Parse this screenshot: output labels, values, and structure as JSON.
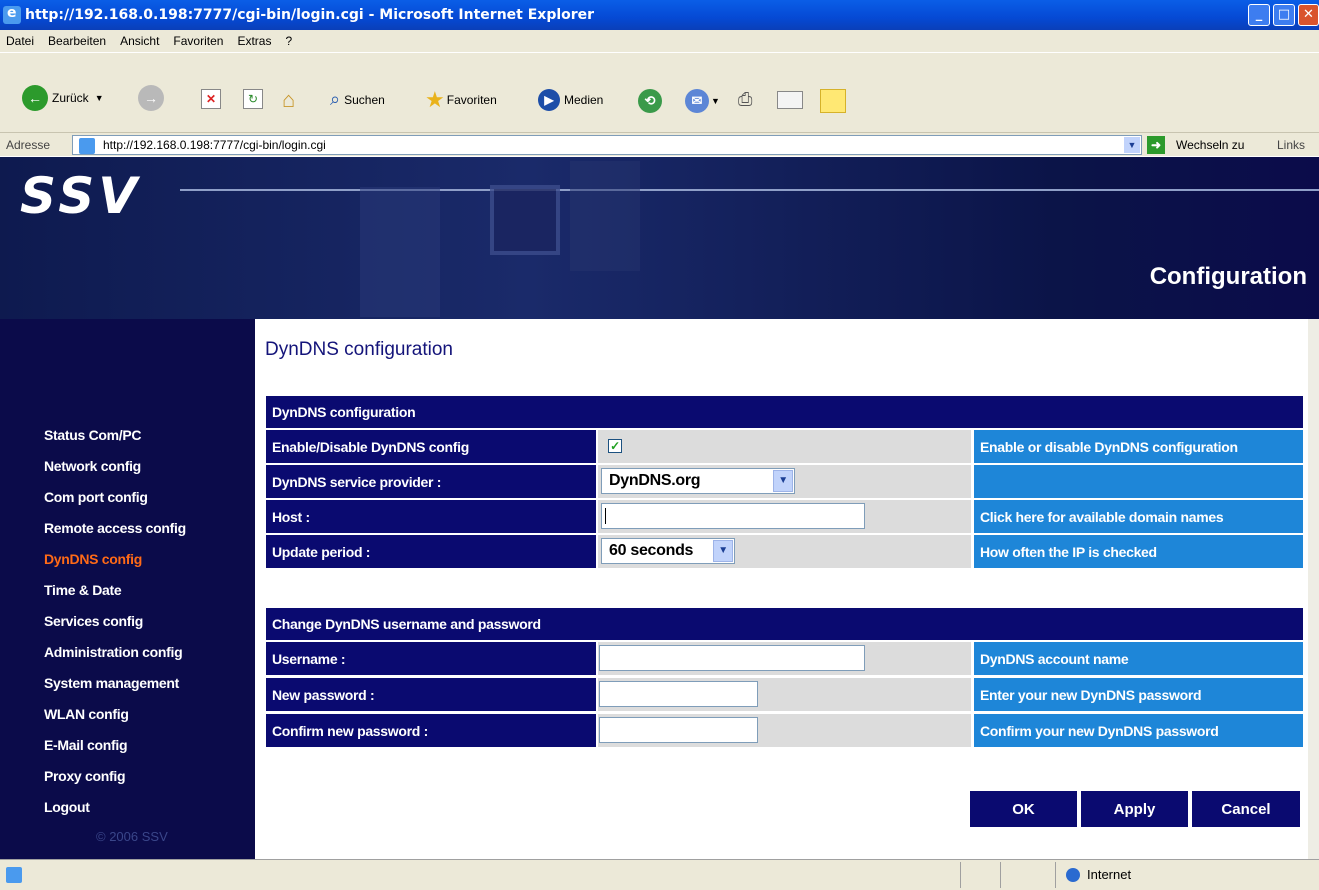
{
  "window": {
    "title": "http://192.168.0.198:7777/cgi-bin/login.cgi - Microsoft Internet Explorer"
  },
  "menu": [
    "Datei",
    "Bearbeiten",
    "Ansicht",
    "Favoriten",
    "Extras",
    "?"
  ],
  "toolbar": {
    "back": "Zurück",
    "search": "Suchen",
    "favorites": "Favoriten",
    "media": "Medien"
  },
  "address": {
    "label": "Adresse",
    "url": "http://192.168.0.198:7777/cgi-bin/login.cgi",
    "go": "Wechseln zu",
    "links": "Links"
  },
  "header": {
    "logo": "SSV",
    "title": "Configuration"
  },
  "sidebar": {
    "items": [
      {
        "label": "Status Com/PC"
      },
      {
        "label": "Network config"
      },
      {
        "label": "Com port config"
      },
      {
        "label": "Remote access config"
      },
      {
        "label": "DynDNS config"
      },
      {
        "label": "Time & Date"
      },
      {
        "label": "Services config"
      },
      {
        "label": "Administration config"
      },
      {
        "label": "System management"
      },
      {
        "label": "WLAN config"
      },
      {
        "label": "E-Mail config"
      },
      {
        "label": "Proxy config"
      },
      {
        "label": "Logout"
      }
    ],
    "copyright": "© 2006 SSV"
  },
  "page": {
    "title": "DynDNS configuration"
  },
  "section1": {
    "header": "DynDNS configuration",
    "enable_label": "Enable/Disable DynDNS config",
    "enable_checked": "✓",
    "enable_help": "Enable or disable DynDNS configuration",
    "provider_label": "DynDNS service provider :",
    "provider_value": "DynDNS.org",
    "host_label": "Host :",
    "host_help": "Click here for available domain names",
    "period_label": "Update period :",
    "period_value": "60 seconds",
    "period_help": "How often the IP is checked"
  },
  "section2": {
    "header": "Change DynDNS username and password",
    "user_label": "Username :",
    "user_help": "DynDNS account name",
    "newpw_label": "New password :",
    "newpw_help": "Enter your new DynDNS password",
    "confpw_label": "Confirm new password :",
    "confpw_help": "Confirm  your new DynDNS password"
  },
  "buttons": {
    "ok": "OK",
    "apply": "Apply",
    "cancel": "Cancel"
  },
  "status": {
    "zone": "Internet"
  },
  "colors": {
    "dark": "#0a0a70",
    "blue": "#1e86d8",
    "grey": "#dcdcdc",
    "active_nav": "#ff6a17"
  }
}
